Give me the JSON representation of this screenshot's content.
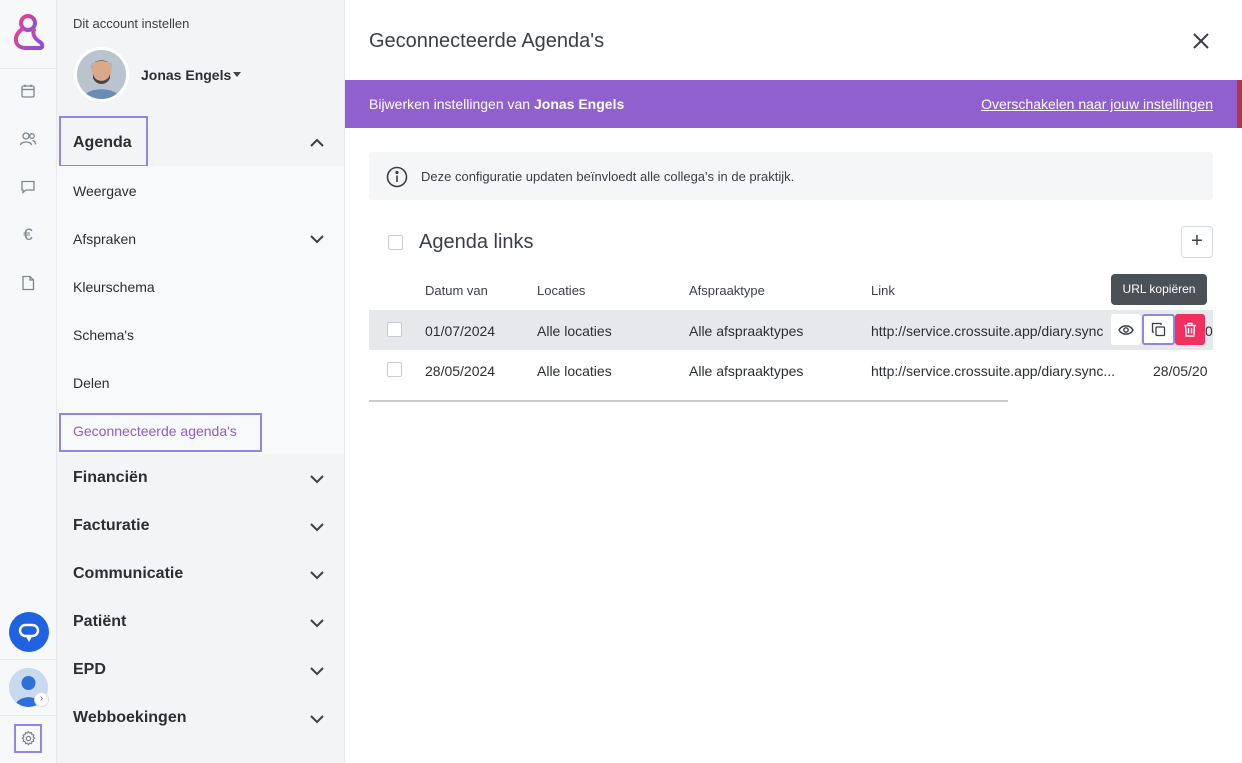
{
  "rail": {
    "icons": [
      "calendar-icon",
      "users-icon",
      "chat-icon",
      "euro-icon",
      "document-icon"
    ],
    "euro_symbol": "€"
  },
  "menu": {
    "account_title": "Dit account instellen",
    "user_name": "Jonas Engels",
    "agenda_label": "Agenda",
    "agenda_items": [
      {
        "label": "Weergave"
      },
      {
        "label": "Afspraken"
      },
      {
        "label": "Kleurschema"
      },
      {
        "label": "Schema's"
      },
      {
        "label": "Delen"
      },
      {
        "label": "Geconnecteerde agenda's"
      }
    ],
    "sections": [
      {
        "label": "Financiën"
      },
      {
        "label": "Facturatie"
      },
      {
        "label": "Communicatie"
      },
      {
        "label": "Patiënt"
      },
      {
        "label": "EPD"
      },
      {
        "label": "Webboekingen"
      }
    ]
  },
  "main": {
    "title": "Geconnecteerde Agenda's",
    "banner": {
      "prefix": "Bijwerken instellingen van ",
      "user": "Jonas Engels",
      "switch_link": "Overschakelen naar jouw instellingen"
    },
    "info_text": "Deze configuratie updaten beïnvloedt alle collega's in de praktijk.",
    "section_title": "Agenda links",
    "add_label": "+",
    "columns": [
      "Datum van",
      "Locaties",
      "Afspraaktype",
      "Link"
    ],
    "rows": [
      {
        "date": "01/07/2024",
        "location": "Alle locaties",
        "type": "Alle afspraaktypes",
        "link": "http://service.crossuite.app/diary.sync",
        "extra": "0"
      },
      {
        "date": "28/05/2024",
        "location": "Alle locaties",
        "type": "Alle afspraaktypes",
        "link": "http://service.crossuite.app/diary.sync...",
        "extra": "28/05/20"
      }
    ],
    "tooltip": "URL kopiëren"
  },
  "colors": {
    "banner": "#9060cf",
    "highlight": "#8f86e8",
    "delete": "#f2305f",
    "chat": "#1f63e0"
  }
}
